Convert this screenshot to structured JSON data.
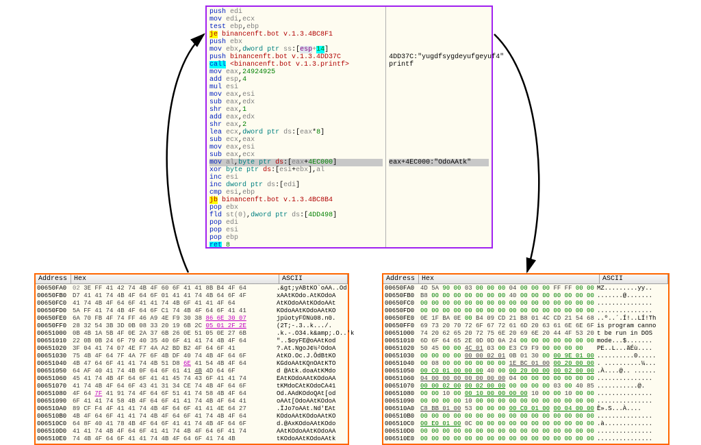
{
  "disasm": {
    "lines": [
      {
        "html": "<span class='op-blue'>push</span> <span class='op-gray'>edi</span>"
      },
      {
        "html": "<span class='op-blue'>mov</span> <span class='op-gray'>edi</span>,<span class='op-gray'>ecx</span>"
      },
      {
        "html": "<span class='op-blue'>test</span> <span class='op-gray'>ebp</span>,<span class='op-gray'>ebp</span>"
      },
      {
        "html": "<span class='hl-yellow op-red'>je</span> <span class='op-red'>binancenft.bot v.1.3.4BC8F1</span>"
      },
      {
        "html": "<span class='op-blue'>push</span> <span class='op-gray'>ebx</span>"
      },
      {
        "html": "<span class='op-blue'>mov</span> <span class='op-gray'>ebx</span>,<span class='op-teal'>dword ptr</span> <span class='op-gray'>ss</span>:[<span class='hl-pale op-purple'>esp</span><span class='op-gray'>+</span><span class='hl-cyan op-green'>14</span>]"
      },
      {
        "html": "<span class='op-blue'>push</span> <span class='op-red'>binancenft.bot v.1.3.4DD37C</span>",
        "comment": "4DD37C:\"yugdfsygdeyufgeyuf4\""
      },
      {
        "html": "<span class='hl-cyan op-blue'>call</span> <span class='op-red'>&lt;binancenft.bot v.1.3.printf&gt;</span>",
        "comment": "printf"
      },
      {
        "html": "<span class='op-blue'>mov</span> <span class='op-gray'>eax</span>,<span class='op-green'>24924925</span>"
      },
      {
        "html": "<span class='op-blue'>add</span> <span class='op-gray'>esp</span>,<span class='op-green'>4</span>"
      },
      {
        "html": "<span class='op-blue'>mul</span> <span class='op-gray'>esi</span>"
      },
      {
        "html": "<span class='op-blue'>mov</span> <span class='op-gray'>eax</span>,<span class='op-gray'>esi</span>"
      },
      {
        "html": "<span class='op-blue'>sub</span> <span class='op-gray'>eax</span>,<span class='op-gray'>edx</span>"
      },
      {
        "html": "<span class='op-blue'>shr</span> <span class='op-gray'>eax</span>,<span class='op-green'>1</span>"
      },
      {
        "html": "<span class='op-blue'>add</span> <span class='op-gray'>eax</span>,<span class='op-gray'>edx</span>"
      },
      {
        "html": "<span class='op-blue'>shr</span> <span class='op-gray'>eax</span>,<span class='op-green'>2</span>"
      },
      {
        "html": "<span class='op-blue'>lea</span> <span class='op-gray'>ecx</span>,<span class='op-teal'>dword ptr</span> <span class='op-gray'>ds</span>:[<span class='op-gray'>eax</span>*<span class='op-green'>8</span>]"
      },
      {
        "html": "<span class='op-blue'>sub</span> <span class='op-gray'>ecx</span>,<span class='op-gray'>eax</span>"
      },
      {
        "html": "<span class='op-blue'>mov</span> <span class='op-gray'>eax</span>,<span class='op-gray'>esi</span>"
      },
      {
        "html": "<span class='op-blue'>sub</span> <span class='op-gray'>eax</span>,<span class='op-gray'>ecx</span>"
      },
      {
        "html": "<span class='op-blue'>mov</span> <span class='op-gray'>al</span>,<span class='op-teal'>byte ptr</span> <span class='op-red'>ds</span>:[<span class='op-gray'>eax</span>+<span class='op-green'>4EC000</span>]",
        "comment": "eax+4EC000:\"OdoAAtk\"",
        "hl": true
      },
      {
        "html": "<span class='op-blue'>xor</span> <span class='op-teal'>byte ptr</span> <span class='op-red'>ds</span>:[<span class='op-gray'>esi</span>+<span class='op-gray'>ebx</span>],<span class='op-gray'>al</span>"
      },
      {
        "html": "<span class='op-blue'>inc</span> <span class='op-gray'>esi</span>"
      },
      {
        "html": "<span class='op-blue'>inc</span> <span class='op-teal'>dword ptr</span> <span class='op-gray'>ds</span>:[<span class='op-gray'>edi</span>]"
      },
      {
        "html": "<span class='op-blue'>cmp</span> <span class='op-gray'>esi</span>,<span class='op-gray'>ebp</span>"
      },
      {
        "html": "<span class='hl-yellow op-red'>jb</span> <span class='op-red'>binancenft.bot v.1.3.4BC8B4</span>"
      },
      {
        "html": "<span class='op-blue'>pop</span> <span class='op-gray'>ebx</span>"
      },
      {
        "html": "<span class='op-blue'>fld</span> <span class='op-gray'>st(0)</span>,<span class='op-teal'>dword ptr</span> <span class='op-gray'>ds</span>:[<span class='op-green'>4DD498</span>]"
      },
      {
        "html": "<span class='op-blue'>pop</span> <span class='op-gray'>edi</span>"
      },
      {
        "html": "<span class='op-blue'>pop</span> <span class='op-gray'>esi</span>"
      },
      {
        "html": "<span class='op-blue'>pop</span> <span class='op-gray'>ebp</span>"
      },
      {
        "html": "<span class='hl-cyan op-blue'>ret</span> <span class='op-green'>8</span>"
      }
    ]
  },
  "hexLeft": {
    "headers": {
      "addr": "Address",
      "hex": "Hex",
      "ascii": "ASCII"
    },
    "rows": [
      {
        "addr": "00650FA0",
        "bytes": "<span class='b-gray'>02</span> 3E FF 41 42 74 4B 4F 60 6F 41 41 8B B4 4F 64",
        "ascii": ".&gt;yABtKO`oAA..Od"
      },
      {
        "addr": "00650FB0",
        "bytes": "D7 41 41 74 4B 4F 64 6F 01 41 41 74 4B 64 6F 4F",
        "ascii": "xAAtKOdo.AtKOdoA"
      },
      {
        "addr": "00650FC0",
        "bytes": "41 74 4B 4F 64 6F 41 41 74 4B 6F 41 41 4F 64",
        "ascii": "AtKOdoAAtKOdoAAt"
      },
      {
        "addr": "00650FD0",
        "bytes": "5A FF 41 74 4B 4F 64 6F C1 74 4B 4F 64 6F 41 41",
        "ascii": "KOdoAAtKOdoAAtKO"
      },
      {
        "addr": "00650FE0",
        "bytes": "6A 70 FB 4F 74 FF 46 A9 4E F9 30 38 <span class='b-under b-pink'>86 6E 30 07</span>",
        "ascii": "jpûotyF©Nù08.n0."
      },
      {
        "addr": "00650FF0",
        "bytes": "28 32 54 3B 3D 0B 08 33 20 19 6B 2C <span class='b-under b-pink'>05 01 2F 2E</span>",
        "ascii": "(2T;-.3..k.../."
      },
      {
        "addr": "00651000",
        "bytes": "0B 4B 1A 5B 4F 0E 2A 37 6B 26 0E 51 05 0E 27 6B",
        "ascii": ".k.-.O34.k&amp;.O..'k"
      },
      {
        "addr": "00651010",
        "bytes": "22 0B 0B 24 6F 79 40 35 40 6F 41 41 74 4B 4F 64",
        "ascii": "\"..$oyFE@oAAtKod"
      },
      {
        "addr": "00651020",
        "bytes": "3F 04 41 74 07 4E F7 4A A2 BD B2 4F 64 6F 41",
        "ascii": "?.At.NgoJ¢½²OdoA"
      },
      {
        "addr": "00651030",
        "bytes": "75 4B 4F 64 7F 4A 7F 6F 4B DF 40 74 4B 4F 64 6F",
        "ascii": "AtKO.Oc.J.ÔdBtKO"
      },
      {
        "addr": "00651040",
        "bytes": "4B 47 64 6F 41 41 74 4B 51 D8 <span class='b-under b-pink'>6E</span> 41 54 4B 4F 64",
        "ascii": "KGdoAAtKQnOAtKTO"
      },
      {
        "addr": "00651050",
        "bytes": "64 AF 40 41 74 4B 0F 64 6F 61 41 <span class='b-under'>4B</span> 4D 64 6F",
        "ascii": "d @Atk.doaAtKMdo"
      },
      {
        "addr": "00651060",
        "bytes": "45 41 74 4B 4F 64 6F 41 41 45 74 43 6F 41 41 74",
        "ascii": "EAtKOdoAAtKOdoAA"
      },
      {
        "addr": "00651070",
        "bytes": "41 74 4B 4F 64 6F 43 41 31 34 CE 74 4B 4F 64 6F",
        "ascii": "tKMdoCAtKOdoCA41"
      },
      {
        "addr": "00651080",
        "bytes": "4F 64 <span class='b-under b-pink'>7F</span> 41 91 74 4F 64 6F 51 41 74 58 4B 4F 64",
        "ascii": "Od.AAdKOdoQAt[od"
      },
      {
        "addr": "00651090",
        "bytes": "6F 41 41 74 58 4B 4F 64 6F 41 41 74 4B 4F 64 41",
        "ascii": "oAAt[OdoAAtKOdoA"
      },
      {
        "addr": "006510A0",
        "bytes": "89 CF F4 4F 41 41 74 4B 4F 64 6F 41 41 4E 64 27",
        "ascii": ".ÏJo7oAAt.Nd'EAt"
      },
      {
        "addr": "006510B0",
        "bytes": "4B 4F 64 6F 41 41 74 4B 4F 64 6F 41 74 4B 4F 64",
        "ascii": "KOdoAAtKOdoAAtKO"
      },
      {
        "addr": "006510C0",
        "bytes": "64 8F 40 41 78 4B 4F 64 6F 41 41 74 4B 4F 64 6F",
        "ascii": "d.@AxKOdoAAtKOdo"
      },
      {
        "addr": "006510D0",
        "bytes": "41 41 74 4B 4F 64 6F 41 41 74 4B 4F 64 6F 41 74",
        "ascii": "AAtKOdoAAtKOdoAA"
      },
      {
        "addr": "006510E0",
        "bytes": "74 4B 4F 64 6F 41 41 74 4B 4F 64 6F 41 74 4B",
        "ascii": "tKOdoAAtKOdoAAtk"
      }
    ]
  },
  "hexRight": {
    "headers": {
      "addr": "Address",
      "hex": "Hex",
      "ascii": "ASCII"
    },
    "rows": [
      {
        "addr": "00650FA0",
        "bytes": "4D 5A <span class='b-green'>90 00</span> 03 <span class='b-green'>00 00 00</span> 04 <span class='b-green'>00 00 00</span> FF FF <span class='b-green'>00 00</span>",
        "ascii": "MZ.........yy.."
      },
      {
        "addr": "00650FB0",
        "bytes": "B8 <span class='b-green'>00 00 00 00 00 00 00</span> 40 <span class='b-green'>00 00 00 00 00 00 00</span>",
        "ascii": ".......@......."
      },
      {
        "addr": "00650FC0",
        "bytes": "<span class='b-green'>00 00 00 00 00 00 00 00 00 00 00 00 00 00 00 00</span>",
        "ascii": "..............."
      },
      {
        "addr": "00650FD0",
        "bytes": "<span class='b-green'>00 00 00 00 00 00 00 00 00 00 00 00 00 00 00 00</span>",
        "ascii": "..............."
      },
      {
        "addr": "00650FE0",
        "bytes": "0E 1F BA 0E <span class='b-green'>00</span> B4 09 CD 21 B8 01 4C CD 21 54 68",
        "ascii": "..º..´.Í!..LÍ!Th"
      },
      {
        "addr": "00650FF0",
        "bytes": "69 73 20 70 72 6F 67 72 61 6D 20 63 61 6E 6E 6F",
        "ascii": "is program canno"
      },
      {
        "addr": "00651000",
        "bytes": "74 20 62 65 20 72 75 6E 20 69 6E 20 44 4F 53 20",
        "ascii": "t be run in DOS "
      },
      {
        "addr": "00651010",
        "bytes": "6D 6F 64 65 2E 0D 0D 0A 24 <span class='b-green'>00 00 00 00 00 00 00</span>",
        "ascii": "mode...$......."
      },
      {
        "addr": "00651020",
        "bytes": "50 45 <span class='b-green'>00 00</span> <span class='b-under'>4C 01</span> 03 <span class='b-green'>00</span> E3 C9 F9 <span class='b-green'>00 00 00 00</span>",
        "ascii": "PE..L...ãÉù...."
      },
      {
        "addr": "00651030",
        "bytes": "<span class='b-green'>00 00 00 00</span> <span class='b-under'>00 00 02 01</span> 0B 01 30 <span class='b-green'>00</span> <span class='b-underg'>00 9E 01 00</span>",
        "ascii": "..........0....."
      },
      {
        "addr": "00651040",
        "bytes": "<span class='b-green'>00</span> 08 <span class='b-green'>00 00 00 00 00 00</span> <span class='b-under'>1E BC 01 00</span> <span class='b-underg'>00 20 00 00</span>",
        "ascii": ". ..........¼..."
      },
      {
        "addr": "00651050",
        "bytes": "<span class='b-underg'>00 C0 01 00 00 00</span> 40 <span class='b-green'>00</span> <span class='b-underg'>00 20 00 00</span> <span class='b-underg'>00 02 00 00</span>",
        "ascii": ".À....@.. ......"
      },
      {
        "addr": "00651060",
        "bytes": "<span class='b-under'>04 00 00 00 00 00 00 00</span> 04 <span class='b-green'>00 00 00 00 00 00 00</span>",
        "ascii": "..............."
      },
      {
        "addr": "00651070",
        "bytes": "<span class='b-underg'>00 00 02 00</span> <span class='b-underg'>00 02 00 00</span> <span class='b-green'>00 00 00 00</span> 03 <span class='b-green'>00</span> 40 85",
        "ascii": "...........@."
      },
      {
        "addr": "00651080",
        "bytes": "<span class='b-green'>00 00</span> 10 <span class='b-green'>00</span> <span class='b-underg'>00 10 00 00 00 00</span> 10 <span class='b-green'>00 00</span> 10 <span class='b-green'>00 00</span>",
        "ascii": "..............."
      },
      {
        "addr": "00651090",
        "bytes": "<span class='b-green'>00 00 00 00</span> 10 <span class='b-green'>00 00 00 00 00 00 00 00 00 00 00</span>",
        "ascii": "..............."
      },
      {
        "addr": "006510A0",
        "bytes": "<span class='b-under'>C8 BB 01 00</span> 53 <span class='b-green'>00 00 00</span> <span class='b-underg'>00 C0 01 00</span> <span class='b-underg'>00 04 00 00</span>",
        "ascii": "È».S...À...."
      },
      {
        "addr": "006510B0",
        "bytes": "<span class='b-green'>00 00 00 00 00 00 00 00 00 00 00 00 00 00 00 00</span>",
        "ascii": "..............."
      },
      {
        "addr": "006510C0",
        "bytes": "<span class='b-underg'>00 E0 01 00</span> 0C <span class='b-green'>00 00 00 00 00 00 00 00 00 00 00</span>",
        "ascii": ".à............."
      },
      {
        "addr": "006510D0",
        "bytes": "<span class='b-green'>00 00 00 00 00 00 00 00 00 00 00 00 00 00 00 00</span>",
        "ascii": "..............."
      },
      {
        "addr": "006510E0",
        "bytes": "<span class='b-green'>00 00 00 00 00 00 00 00 00 00 00 00 00 00 00 00</span>",
        "ascii": "..............."
      }
    ]
  }
}
